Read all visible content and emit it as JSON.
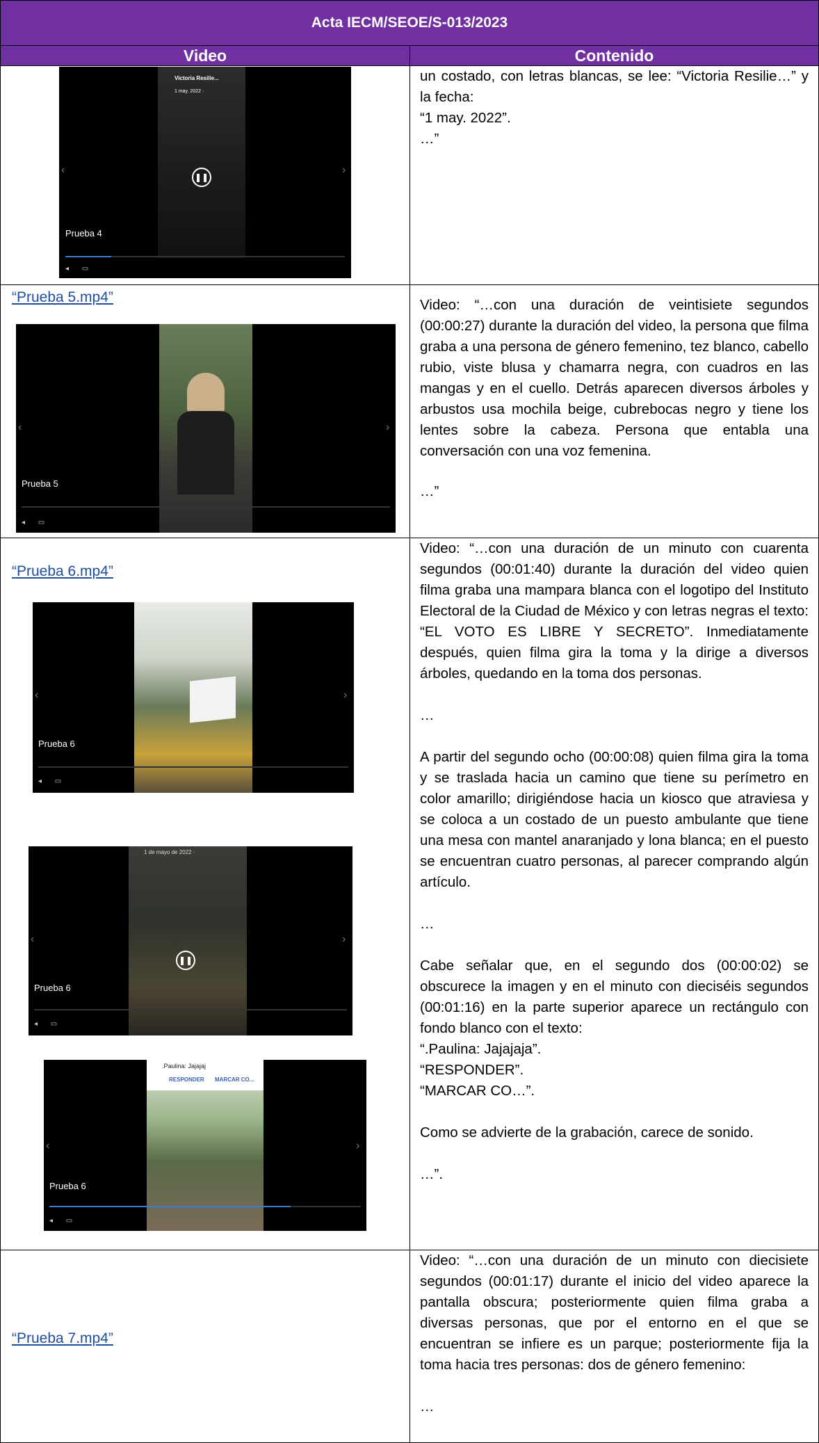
{
  "title": "Acta IECM/SEOE/S-013/2023",
  "columns": {
    "video": "Video",
    "contenido": "Contenido"
  },
  "row1": {
    "shot": {
      "label": "Prueba 4",
      "account": "Victoria Resilie...",
      "date": "1 may. 2022 ·"
    },
    "paragraphs": [
      "un costado, con letras blancas, se lee: “Victoria Resilie…” y la fecha:",
      "“1 may. 2022”.",
      "…”"
    ]
  },
  "row2": {
    "link": "“Prueba 5.mp4”",
    "shot": {
      "label": "Prueba 5"
    },
    "paragraphs": [
      "Video: “…con una duración de veintisiete segundos (00:00:27) durante la duración del video, la persona que filma graba a una persona de género femenino, tez blanco, cabello rubio, viste blusa y chamarra negra, con cuadros en las mangas y en el cuello. Detrás aparecen diversos árboles y arbustos usa mochila beige, cubrebocas negro y tiene los lentes sobre la cabeza. Persona que entabla una conversación con una voz femenina.",
      "…”"
    ]
  },
  "row3": {
    "link": "“Prueba 6.mp4”",
    "shots": [
      {
        "label": "Prueba 6"
      },
      {
        "label": "Prueba 6",
        "date": "1 de mayo de 2022 ·"
      },
      {
        "label": "Prueba 6",
        "chat": ".Paulina: Jajajaj",
        "btn1": "RESPONDER",
        "btn2": "MARCAR CO..."
      }
    ],
    "paragraphs": [
      "Video: “…con una duración de un minuto con cuarenta segundos (00:01:40) durante la duración del video quien filma graba una mampara blanca con el logotipo del Instituto Electoral de la Ciudad de México y con letras negras el texto: “EL VOTO ES LIBRE Y SECRETO”. Inmediatamente después, quien filma gira la toma y la dirige a diversos árboles, quedando en la toma dos personas.",
      "…",
      "A partir del segundo ocho (00:00:08) quien filma gira la toma y se traslada hacia un camino que tiene su perímetro en color amarillo; dirigiéndose hacia un kiosco que atraviesa y se coloca a un costado de un puesto ambulante que tiene una mesa con mantel anaranjado y lona blanca; en el puesto se encuentran cuatro personas, al parecer comprando algún artículo.",
      "…",
      "Cabe señalar que, en el segundo dos (00:00:02) se obscurece la imagen y en el minuto con dieciséis segundos (00:01:16) en la parte superior aparece un rectángulo con fondo blanco con el texto:",
      "“.Paulina: Jajajaja”.",
      "“RESPONDER”.",
      "“MARCAR CO…”.",
      "Como se advierte de la grabación, carece de sonido.",
      "…”."
    ]
  },
  "row4": {
    "link": "“Prueba 7.mp4”",
    "paragraphs": [
      "Video: “…con una duración de un minuto con diecisiete segundos (00:01:17) durante el inicio del video aparece la pantalla obscura; posteriormente quien filma graba a diversas personas, que por el entorno en el que se encuentran se infiere es un parque; posteriormente fija la toma hacia tres personas: dos de género femenino:",
      "…"
    ]
  }
}
